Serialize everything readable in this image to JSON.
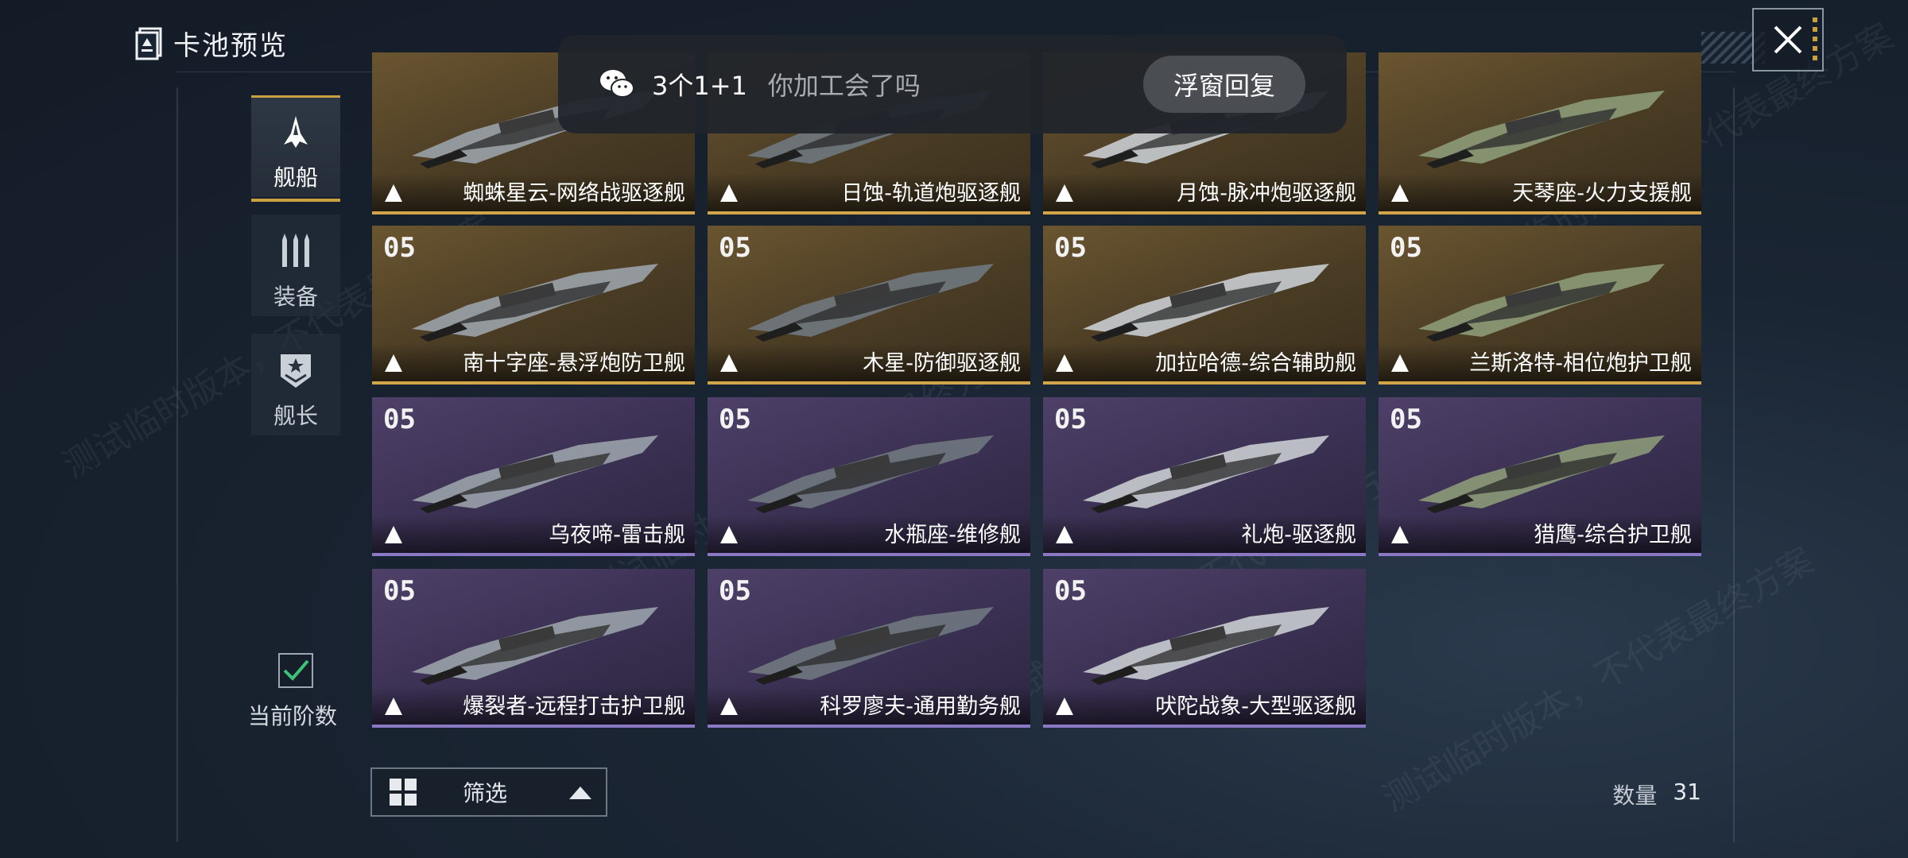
{
  "window": {
    "title": "卡池预览"
  },
  "notification": {
    "sender": "3个1+1",
    "message": "你加工会了吗",
    "action": "浮窗回复"
  },
  "tabs": [
    {
      "label": "舰船",
      "active": true
    },
    {
      "label": "装备",
      "active": false
    },
    {
      "label": "舰长",
      "active": false
    }
  ],
  "stage_toggle": {
    "label": "当前阶数",
    "checked": true
  },
  "cards": [
    {
      "level": "",
      "name": "蜘蛛星云-网络战驱逐舰",
      "rarity": "gold"
    },
    {
      "level": "",
      "name": "日蚀-轨道炮驱逐舰",
      "rarity": "gold"
    },
    {
      "level": "",
      "name": "月蚀-脉冲炮驱逐舰",
      "rarity": "gold"
    },
    {
      "level": "",
      "name": "天琴座-火力支援舰",
      "rarity": "gold"
    },
    {
      "level": "05",
      "name": "南十字座-悬浮炮防卫舰",
      "rarity": "gold"
    },
    {
      "level": "05",
      "name": "木星-防御驱逐舰",
      "rarity": "gold"
    },
    {
      "level": "05",
      "name": "加拉哈德-综合辅助舰",
      "rarity": "gold"
    },
    {
      "level": "05",
      "name": "兰斯洛特-相位炮护卫舰",
      "rarity": "gold"
    },
    {
      "level": "05",
      "name": "乌夜啼-雷击舰",
      "rarity": "purple"
    },
    {
      "level": "05",
      "name": "水瓶座-维修舰",
      "rarity": "purple"
    },
    {
      "level": "05",
      "name": "礼炮-驱逐舰",
      "rarity": "purple"
    },
    {
      "level": "05",
      "name": "猎鹰-综合护卫舰",
      "rarity": "purple"
    },
    {
      "level": "05",
      "name": "爆裂者-远程打击护卫舰",
      "rarity": "purple"
    },
    {
      "level": "05",
      "name": "科罗廖夫-通用勤务舰",
      "rarity": "purple"
    },
    {
      "level": "05",
      "name": "吠陀战象-大型驱逐舰",
      "rarity": "purple"
    }
  ],
  "filter": {
    "label": "筛选"
  },
  "count": {
    "label": "数量",
    "value": "31"
  },
  "watermarks": [
    "测试临时版本，不代表最终方案"
  ],
  "colors": {
    "gold_border": "#d2a54a",
    "purple_border": "#8a78c4",
    "active_tab": "#c8a040",
    "check": "#3ec27a"
  },
  "icons": {
    "title": "book-icon",
    "close": "close-icon",
    "notification": "wechat-icon",
    "ship_tab": "spaceship-icon",
    "equip_tab": "missile-icon",
    "captain_tab": "rank-badge-icon",
    "class": "triangle-class-icon",
    "filter": "grid-icon",
    "check": "checkmark-icon"
  }
}
